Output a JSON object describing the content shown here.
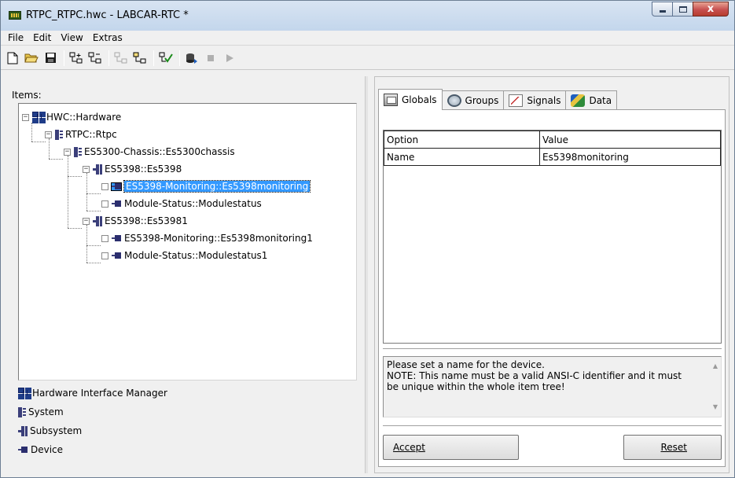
{
  "window": {
    "title": "RTPC_RTPC.hwc - LABCAR-RTC  *",
    "close_glyph": "x"
  },
  "menu": [
    "File",
    "Edit",
    "View",
    "Extras"
  ],
  "left": {
    "items_label": "Items:",
    "tree": [
      {
        "label": "HWC::Hardware",
        "icon": "hardware-icon",
        "expander": "−"
      },
      {
        "label": "RTPC::Rtpc",
        "icon": "system-icon",
        "expander": "−"
      },
      {
        "label": "ES5300-Chassis::Es5300chassis",
        "icon": "system-icon",
        "expander": "−"
      },
      {
        "label": "ES5398::Es5398",
        "icon": "subsystem-icon",
        "expander": "−"
      },
      {
        "label": "ES5398-Monitoring::Es5398monitoring",
        "icon": "device-icon",
        "selected": true
      },
      {
        "label": "Module-Status::Modulestatus",
        "icon": "device-icon"
      },
      {
        "label": "ES5398::Es53981",
        "icon": "subsystem-icon",
        "expander": "−"
      },
      {
        "label": "ES5398-Monitoring::Es5398monitoring1",
        "icon": "device-icon"
      },
      {
        "label": "Module-Status::Modulestatus1",
        "icon": "device-icon"
      }
    ],
    "legend": [
      {
        "label": "Hardware Interface Manager",
        "icon": "hardware-icon"
      },
      {
        "label": "System",
        "icon": "system-icon"
      },
      {
        "label": "Subsystem",
        "icon": "subsystem-icon"
      },
      {
        "label": "Device",
        "icon": "device-icon"
      }
    ]
  },
  "right": {
    "tabs": [
      {
        "label": "Globals",
        "active": true
      },
      {
        "label": "Groups"
      },
      {
        "label": "Signals"
      },
      {
        "label": "Data"
      }
    ],
    "grid": {
      "headers": [
        "Option",
        "Value"
      ],
      "rows": [
        [
          "Name",
          "Es5398monitoring"
        ]
      ]
    },
    "description": {
      "line1": "Please set a name for the device.",
      "line2": "NOTE: This name must be a valid ANSI-C identifier and it must",
      "line3": "be unique within the whole item tree!"
    },
    "accept_label": "Accept",
    "reset_label": "Reset"
  }
}
